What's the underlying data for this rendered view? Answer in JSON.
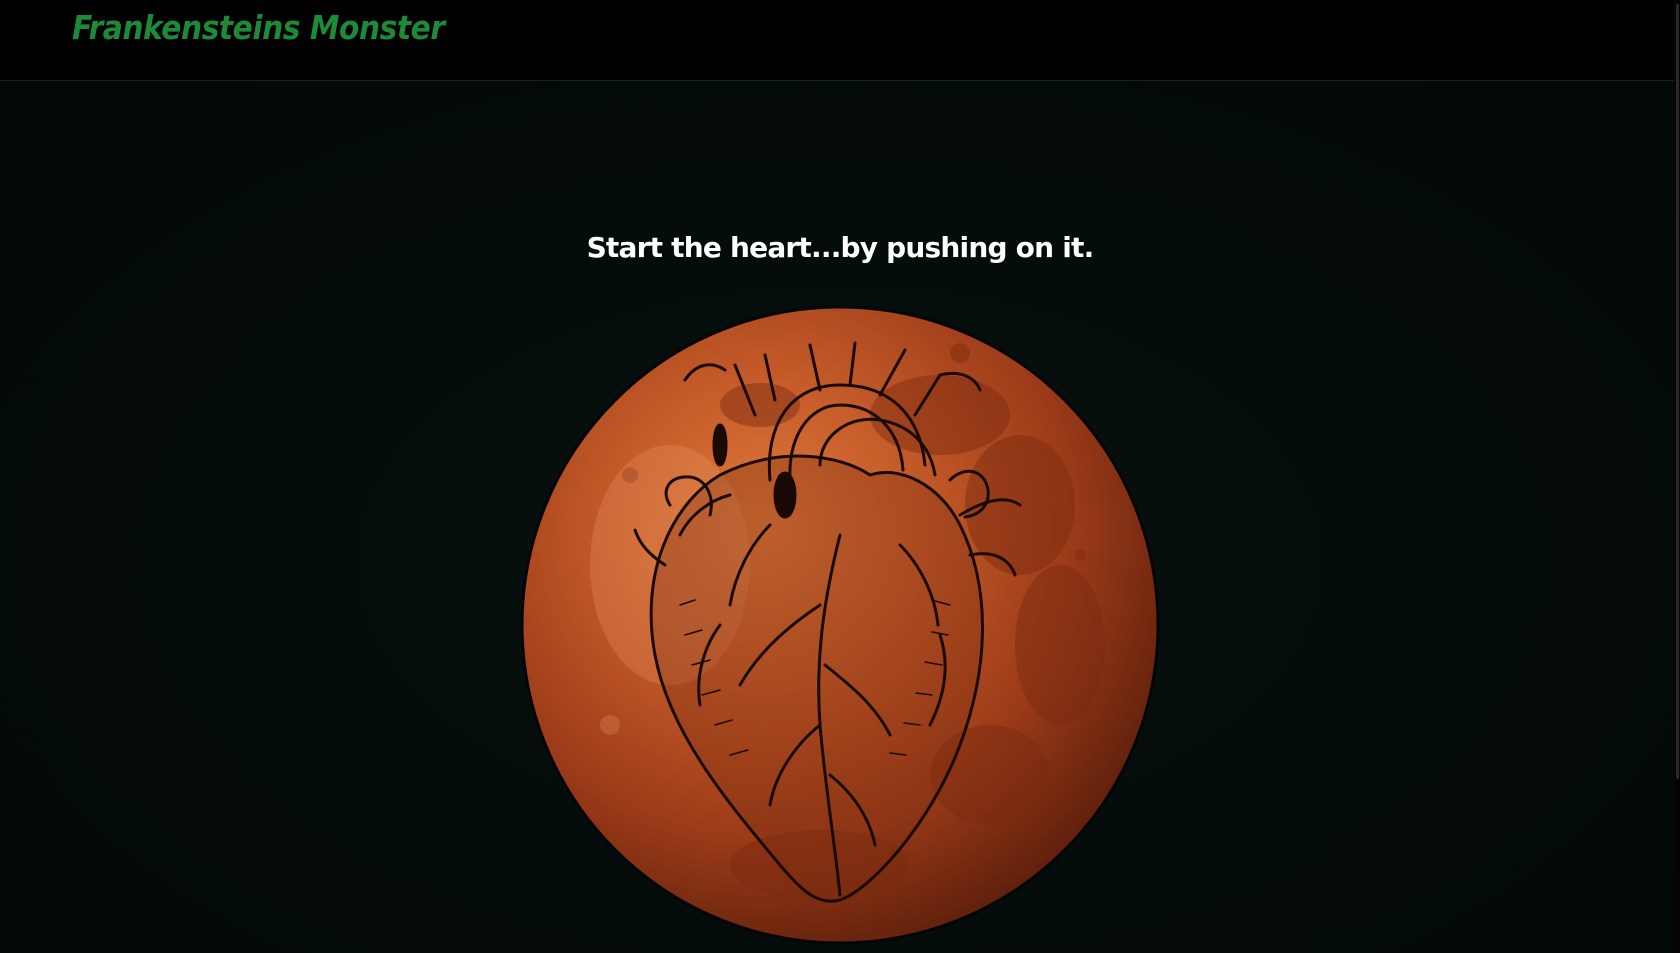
{
  "navbar": {
    "brand": "Frankensteins Monster"
  },
  "main": {
    "instruction": "Start the heart...by pushing on it."
  },
  "heart": {
    "icon": "anatomical-heart-on-blood-moon",
    "moon_color": "#b84a22",
    "heart_line_color": "#1a0a06"
  },
  "colors": {
    "brand": "#1d8a37",
    "background": "#030b0b",
    "navbar": "#010101",
    "text": "#ffffff"
  }
}
